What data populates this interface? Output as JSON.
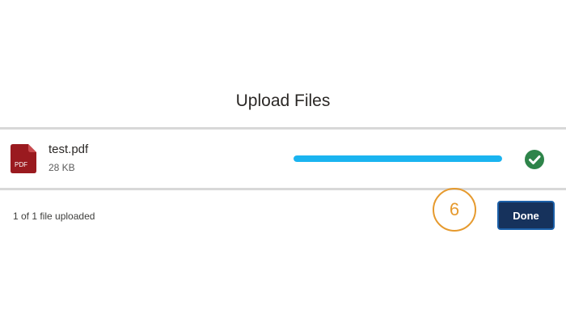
{
  "modal": {
    "title": "Upload Files"
  },
  "file": {
    "name": "test.pdf",
    "size": "28 KB",
    "icon": "pdf-file-icon",
    "icon_label": "PDF",
    "progress_percent": 100,
    "status_icon": "check-circle-icon"
  },
  "footer": {
    "status": "1 of 1 file uploaded",
    "step_number": "6",
    "done_label": "Done"
  },
  "colors": {
    "pdf_icon": "#9a1a1f",
    "progress": "#1ab4f0",
    "success": "#2e844a",
    "step_marker": "#e69a2e",
    "button_bg": "#16325c",
    "button_border": "#1b5fa8"
  }
}
